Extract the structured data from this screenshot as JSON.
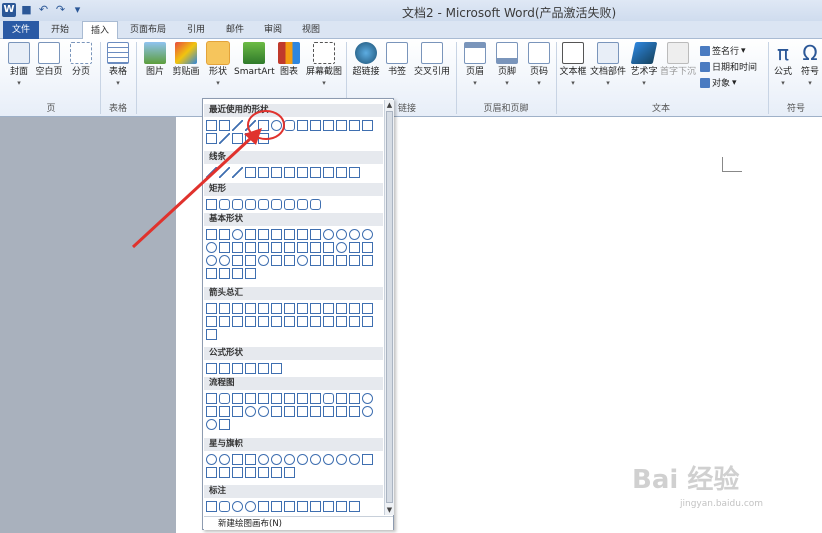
{
  "titlebar": {
    "app_icon": "W",
    "title": "文档2 - Microsoft Word(产品激活失败)"
  },
  "tabs": [
    "文件",
    "开始",
    "插入",
    "页面布局",
    "引用",
    "邮件",
    "审阅",
    "视图"
  ],
  "ribbon": {
    "buttons": [
      "封面",
      "空白页",
      "分页",
      "表格",
      "图片",
      "剪贴画",
      "形状",
      "SmartArt",
      "图表",
      "屏幕截图",
      "超链接",
      "书签",
      "交叉引用",
      "页眉",
      "页脚",
      "页码",
      "文本框",
      "文档部件",
      "艺术字",
      "首字下沉",
      "公式",
      "符号"
    ],
    "small": [
      "签名行",
      "日期和时间",
      "对象"
    ],
    "groups": [
      "页",
      "表格",
      "链接",
      "页眉和页脚",
      "文本",
      "符号"
    ]
  },
  "gallery": {
    "categories": [
      "最近使用的形状",
      "线条",
      "矩形",
      "基本形状",
      "箭头总汇",
      "公式形状",
      "流程图",
      "星与旗帜",
      "标注"
    ],
    "new_canvas": "新建绘图画布(N)"
  },
  "watermark": {
    "brand": "Bai 经验",
    "url": "jingyan.baidu.com"
  },
  "colors": {
    "file_tab": "#2a5aa5",
    "selected": "#f6c55c",
    "annotation": "#e0322d"
  }
}
